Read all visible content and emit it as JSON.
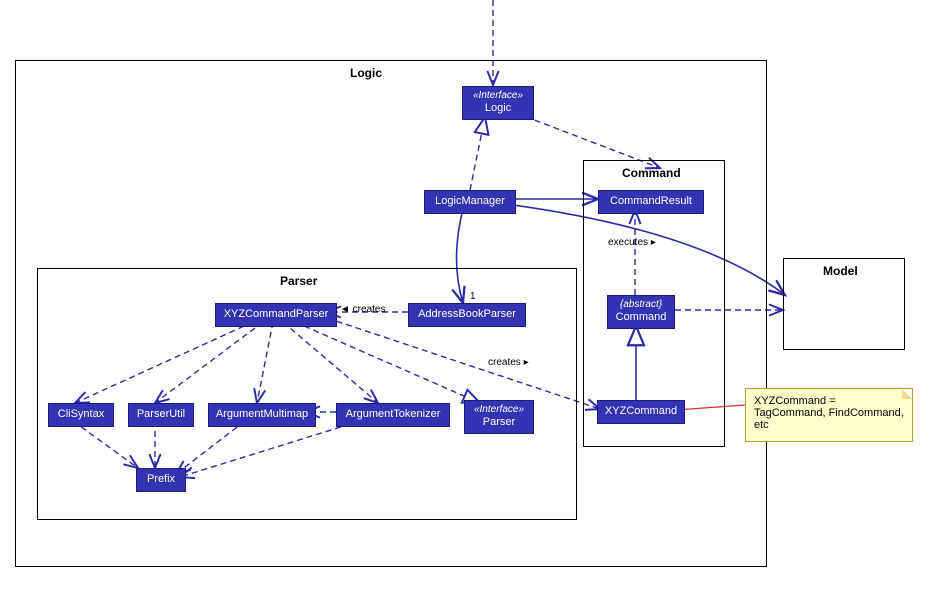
{
  "packages": {
    "logic": {
      "label": "Logic"
    },
    "parser": {
      "label": "Parser"
    },
    "command": {
      "label": "Command"
    },
    "model": {
      "label": "Model"
    }
  },
  "nodes": {
    "iface_logic": {
      "stereo": "«Interface»",
      "name": "Logic"
    },
    "logic_manager": {
      "name": "LogicManager"
    },
    "command_result": {
      "name": "CommandResult"
    },
    "abstract_command": {
      "stereo": "{abstract}",
      "name": "Command"
    },
    "xyz_command": {
      "name": "XYZCommand"
    },
    "address_book_parser": {
      "name": "AddressBookParser"
    },
    "xyz_command_parser": {
      "name": "XYZCommandParser"
    },
    "argument_tokenizer": {
      "name": "ArgumentTokenizer"
    },
    "argument_multimap": {
      "name": "ArgumentMultimap"
    },
    "parser_util": {
      "name": "ParserUtil"
    },
    "cli_syntax": {
      "name": "CliSyntax"
    },
    "prefix": {
      "name": "Prefix"
    },
    "iface_parser": {
      "stereo": "«Interface»",
      "name": "Parser"
    }
  },
  "labels": {
    "creates_left": "◄ creates",
    "creates_right": "creates ▸",
    "executes": "executes ▸",
    "mult_one": "1"
  },
  "note": {
    "text": "XYZCommand = TagCommand, FindCommand, etc"
  },
  "colors": {
    "node_fill": "#3333b3",
    "edge_dashed": "#2a2aa8",
    "edge_solid": "#2a2aa8",
    "note_bg": "#ffffcc",
    "note_border": "#cc9933",
    "line_to_note": "#cc3333"
  }
}
